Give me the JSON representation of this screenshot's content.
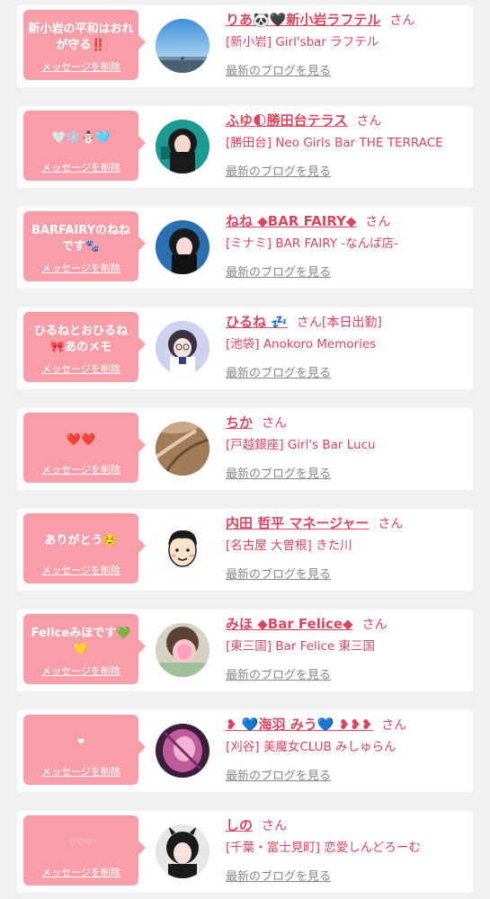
{
  "favorites": [
    {
      "message": "新小岩の平和はおれが守る‼️",
      "delete_label": "メッセージを削除",
      "name": "りあ🐼🖤新小岩ラフテル",
      "san": "さん",
      "status": "",
      "shop": "[新小岩] Girl'sbar ラフテル",
      "blog_link": "最新のブログを見る",
      "avatar": "sky-photo"
    },
    {
      "message": "🤍❄️⛄️🩵",
      "delete_label": "メッセージを削除",
      "name": "ふゆ🌓勝田台テラス",
      "san": "さん",
      "status": "",
      "shop": "[勝田台] Neo Girls Bar THE TERRACE",
      "blog_link": "最新のブログを見る",
      "avatar": "girl-teal"
    },
    {
      "message": "BARFAIRYのねねです🐾",
      "delete_label": "メッセージを削除",
      "name": "ねね ◆BAR FAIRY◆",
      "san": "さん",
      "status": "",
      "shop": "[ミナミ] BAR FAIRY -なんば店-",
      "blog_link": "最新のブログを見る",
      "avatar": "girl-blue"
    },
    {
      "message": "ひるねとおひるね🎀あのメモ",
      "delete_label": "メッセージを削除",
      "name": "ひるね 💤",
      "san": "さん",
      "status": "[本日出勤]",
      "shop": "[池袋] Anokoro Memories",
      "blog_link": "最新のブログを見る",
      "avatar": "girl-lavender"
    },
    {
      "message": "❤️❤️",
      "delete_label": "メッセージを削除",
      "name": "ちか",
      "san": "さん",
      "status": "",
      "shop": "[戸越銀座] Girl's Bar Lucu",
      "blog_link": "最新のブログを見る",
      "avatar": "hair-brown"
    },
    {
      "message": "ありがとう☺️",
      "delete_label": "メッセージを削除",
      "name": "内田 哲平 マネージャー",
      "san": "さん",
      "status": "",
      "shop": "[名古屋 大曽根] きた川",
      "blog_link": "最新のブログを見る",
      "avatar": "illustration-man"
    },
    {
      "message": "Feliceみほです💚💛",
      "delete_label": "メッセージを削除",
      "name": "みほ ◆Bar Felice◆",
      "san": "さん",
      "status": "",
      "shop": "[東三国] Bar Felice 東三国",
      "blog_link": "最新のブログを見る",
      "avatar": "girl-pink-blur"
    },
    {
      "message": "❤",
      "delete_label": "メッセージを削除",
      "name": "❥ 💙海羽 みう💙 ❥❥❥",
      "san": "さん",
      "status": "",
      "shop": "[刈谷] 美魔女CLUB みしゅらん",
      "blog_link": "最新のブログを見る",
      "avatar": "girl-purple-blur"
    },
    {
      "message": "♡♡♡",
      "delete_label": "メッセージを削除",
      "name": "しの",
      "san": "さん",
      "status": "",
      "shop": "[千葉・富士見町] 恋愛しんどろーむ",
      "blog_link": "最新のブログを見る",
      "avatar": "girl-dark-hair"
    }
  ]
}
